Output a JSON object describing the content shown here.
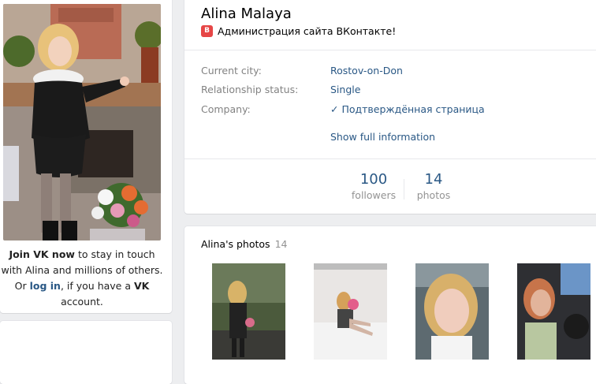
{
  "sidebar": {
    "join_prefix": "Join VK now",
    "join_middle": " to stay in touch with Alina and millions of others. Or ",
    "login_label": "log in",
    "join_suffix_1": ", if you have a ",
    "vk_label": "VK",
    "join_suffix_2": " account."
  },
  "profile": {
    "name": "Alina Malaya",
    "status_icon": "В",
    "status_text": "Администрация сайта ВКонтакте!",
    "rows": [
      {
        "label": "Current city:",
        "value": "Rostov-on-Don"
      },
      {
        "label": "Relationship status:",
        "value": "Single"
      },
      {
        "label": "Company:",
        "value": "✓ Подтверждённая страница"
      }
    ],
    "show_full": "Show full information",
    "counters": [
      {
        "num": "100",
        "label": "followers"
      },
      {
        "num": "14",
        "label": "photos"
      }
    ]
  },
  "photos": {
    "title": "Alina's photos",
    "count": "14"
  },
  "colors": {
    "link": "#2a5885",
    "muted": "#828282",
    "background": "#edeef0",
    "badge": "#e64646"
  }
}
